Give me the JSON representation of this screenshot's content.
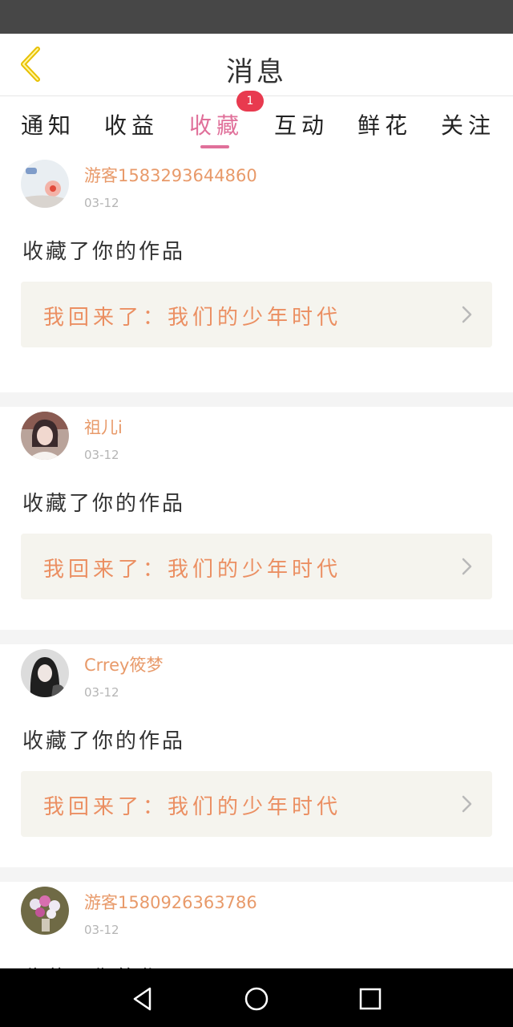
{
  "header": {
    "title": "消息",
    "back_icon": "chevron-left-icon",
    "accent_color": "#e0709a",
    "back_icon_color": "#e8c000"
  },
  "tabs": [
    {
      "label": "通知"
    },
    {
      "label": "收益"
    },
    {
      "label": "收藏",
      "active": true,
      "badge": "1"
    },
    {
      "label": "互动"
    },
    {
      "label": "鲜花"
    },
    {
      "label": "关注"
    }
  ],
  "feed": [
    {
      "username": "游客1583293644860",
      "date": "03-12",
      "action": "收藏了你的作品",
      "work_title": "我回来了：我们的少年时代"
    },
    {
      "username": "祖儿i",
      "date": "03-12",
      "action": "收藏了你的作品",
      "work_title": "我回来了：我们的少年时代"
    },
    {
      "username": "Crrey筱梦",
      "date": "03-12",
      "action": "收藏了你的作品",
      "work_title": "我回来了：我们的少年时代"
    },
    {
      "username": "游客1580926363786",
      "date": "03-12",
      "action": "收藏了你的作品",
      "work_title": ""
    }
  ],
  "colors": {
    "username": "#e89a6a",
    "work_title": "#eb8f62",
    "work_bg": "#f5f4ee",
    "badge": "#e83a4f"
  },
  "system_nav": {
    "back_icon": "triangle-back-icon",
    "home_icon": "circle-home-icon",
    "recents_icon": "square-recents-icon"
  }
}
